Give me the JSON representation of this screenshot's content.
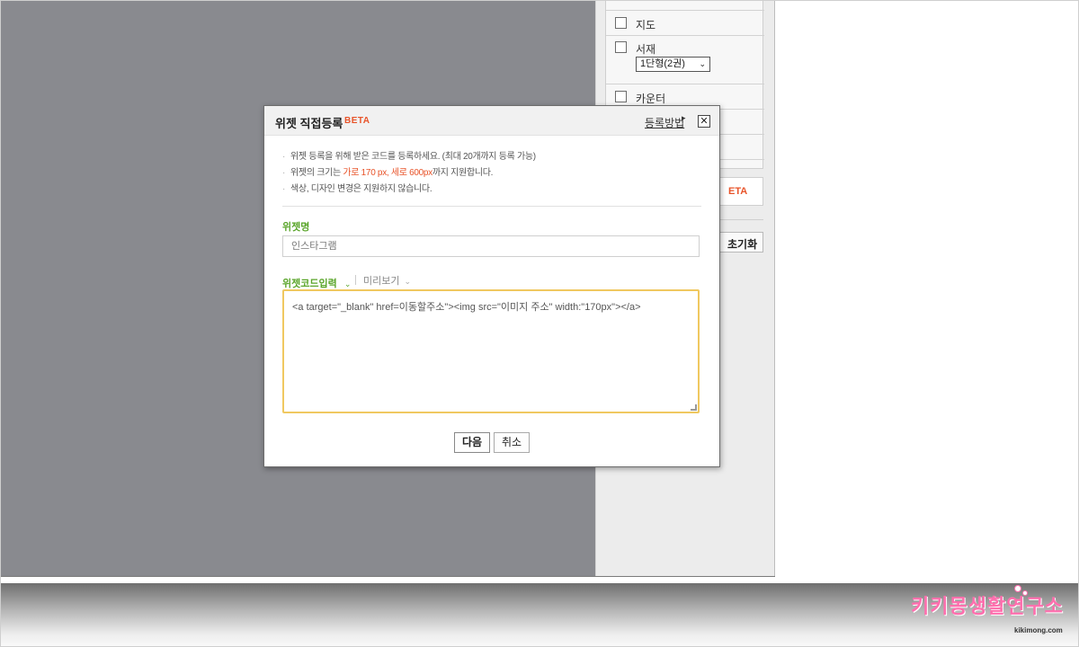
{
  "side_panel": {
    "items": [
      {
        "label": "지도"
      },
      {
        "label": "서재",
        "select_value": "1단형(2권)"
      },
      {
        "label": "카운터"
      }
    ],
    "beta_button_partial": "ETA",
    "reset_button_partial": "초기화"
  },
  "dialog": {
    "title": "위젯 직접등록",
    "beta_tag": "BETA",
    "help_link": "등록방법",
    "close_symbol": "✕",
    "notices": [
      {
        "pre": "위젯 등록을 위해 받은 코드를 등록하세요. (최대 20개까지 등록 가능)",
        "highlight": "",
        "post": ""
      },
      {
        "pre": "위젯의 크기는 ",
        "highlight": "가로 170 px, 세로 600px",
        "post": "까지 지원합니다."
      },
      {
        "pre": "색상, 디자인 변경은 지원하지 않습니다.",
        "highlight": "",
        "post": ""
      }
    ],
    "name_label": "위젯명",
    "name_value": "인스타그램",
    "code_tab_label": "위젯코드입력",
    "preview_tab_label": "미리보기",
    "code_value": "<a target=\"_blank\" href=이동할주소\"><img src=\"이미지 주소\" width:\"170px\"></a>",
    "next_button": "다음",
    "cancel_button": "취소"
  },
  "watermark": {
    "text": "키키몽생활연구소",
    "subtext": "kikimong.com"
  },
  "colors": {
    "accent_orange": "#e8542a",
    "label_green": "#5aa52a",
    "focus_border": "#f0c860",
    "overlay_gray": "#898a8f",
    "watermark_pink": "#ff6fae"
  }
}
